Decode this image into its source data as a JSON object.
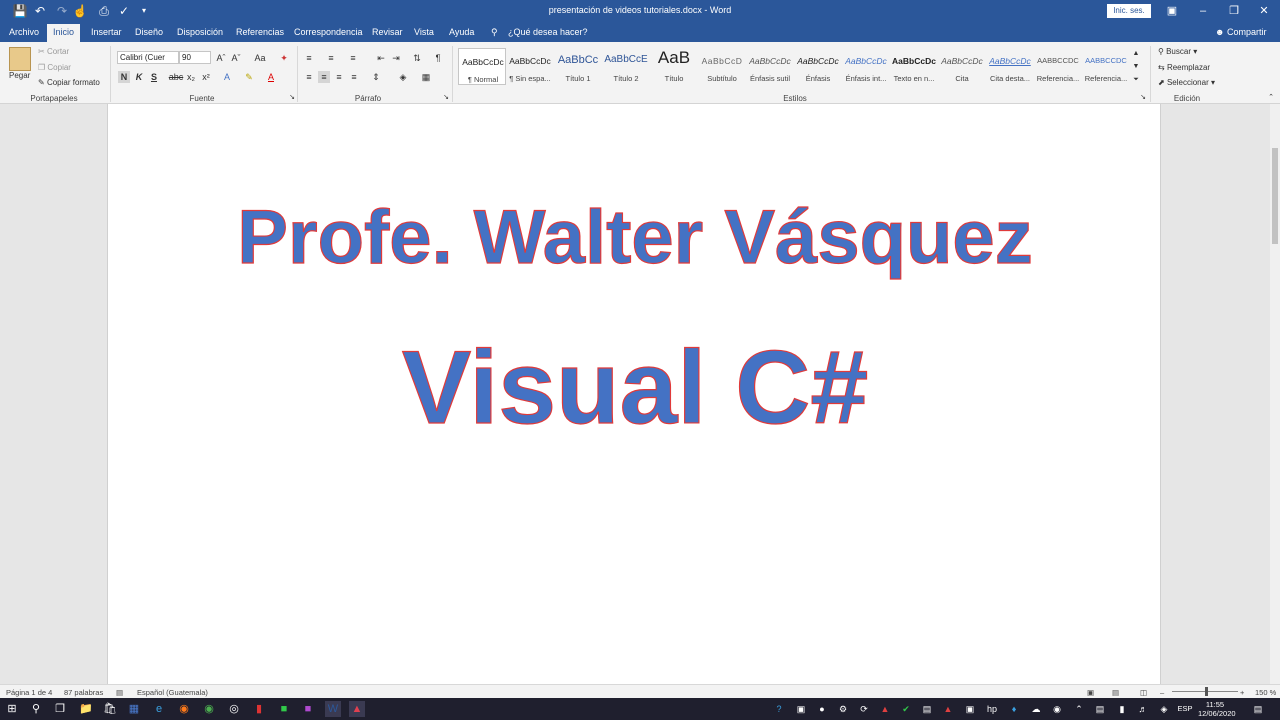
{
  "window": {
    "title": "presentación de videos tutoriales.docx  -  Word",
    "signin": "Inic. ses.",
    "share": "Compartir"
  },
  "menu": {
    "tabs": [
      "Archivo",
      "Inicio",
      "Insertar",
      "Diseño",
      "Disposición",
      "Referencias",
      "Correspondencia",
      "Revisar",
      "Vista",
      "Ayuda"
    ],
    "active": "Inicio",
    "tell_me": "¿Qué desea hacer?"
  },
  "ribbon": {
    "clipboard": {
      "paste": "Pegar",
      "cut": "Cortar",
      "copy": "Copiar",
      "format_painter": "Copiar formato",
      "label": "Portapapeles"
    },
    "font": {
      "name": "Calibri (Cuer",
      "size": "90",
      "label": "Fuente",
      "bold": "N",
      "italic": "K",
      "underline": "S",
      "strike": "abc",
      "sub": "x₂",
      "sup": "x²"
    },
    "paragraph": {
      "label": "Párrafo"
    },
    "styles": {
      "label": "Estilos",
      "items": [
        {
          "preview": "AaBbCcDc",
          "name": "¶ Normal"
        },
        {
          "preview": "AaBbCcDc",
          "name": "¶ Sin espa..."
        },
        {
          "preview": "AaBbCc",
          "name": "Título 1"
        },
        {
          "preview": "AaBbCcE",
          "name": "Título 2"
        },
        {
          "preview": "AaB",
          "name": "Título"
        },
        {
          "preview": "AaBbCcD",
          "name": "Subtítulo"
        },
        {
          "preview": "AaBbCcDc",
          "name": "Énfasis sutil"
        },
        {
          "preview": "AaBbCcDc",
          "name": "Énfasis"
        },
        {
          "preview": "AaBbCcDc",
          "name": "Énfasis int..."
        },
        {
          "preview": "AaBbCcDc",
          "name": "Texto en n..."
        },
        {
          "preview": "AaBbCcDc",
          "name": "Cita"
        },
        {
          "preview": "AaBbCcDc",
          "name": "Cita desta..."
        },
        {
          "preview": "AABBCCDC",
          "name": "Referencia..."
        },
        {
          "preview": "AABBCCDC",
          "name": "Referencia..."
        }
      ]
    },
    "editing": {
      "find": "Buscar",
      "replace": "Reemplazar",
      "select": "Seleccionar",
      "label": "Edición"
    }
  },
  "document": {
    "line1": "Profe. Walter Vásquez",
    "line2": "Visual C#"
  },
  "status": {
    "page": "Página 1 de 4",
    "words": "87 palabras",
    "language": "Español (Guatemala)",
    "zoom": "150 %"
  },
  "taskbar": {
    "language": "ESP",
    "time": "11:55",
    "date": "12/06/2020"
  }
}
